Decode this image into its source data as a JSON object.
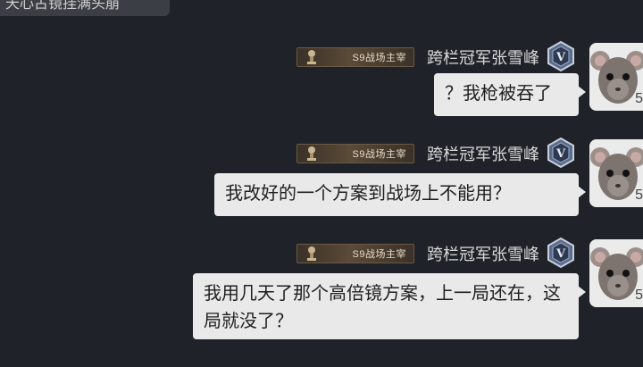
{
  "top_message": "天心古镜挂满头崩",
  "messages": [
    {
      "title_badge": "S9战场主宰",
      "sender": "跨栏冠军张雪峰",
      "rank": "V",
      "level": "5",
      "text": "？我枪被吞了"
    },
    {
      "title_badge": "S9战场主宰",
      "sender": "跨栏冠军张雪峰",
      "rank": "V",
      "level": "5",
      "text": "我改好的一个方案到战场上不能用？"
    },
    {
      "title_badge": "S9战场主宰",
      "sender": "跨栏冠军张雪峰",
      "rank": "V",
      "level": "5",
      "text": "我用几天了那个高倍镜方案，上一局还在，这局就没了？"
    }
  ],
  "colors": {
    "background": "#1f2228",
    "bubble": "#e9e9e9",
    "badge_gold": "#e8dcc6"
  },
  "icons": [
    "trophy-icon",
    "rank-v-icon",
    "rat-avatar"
  ]
}
